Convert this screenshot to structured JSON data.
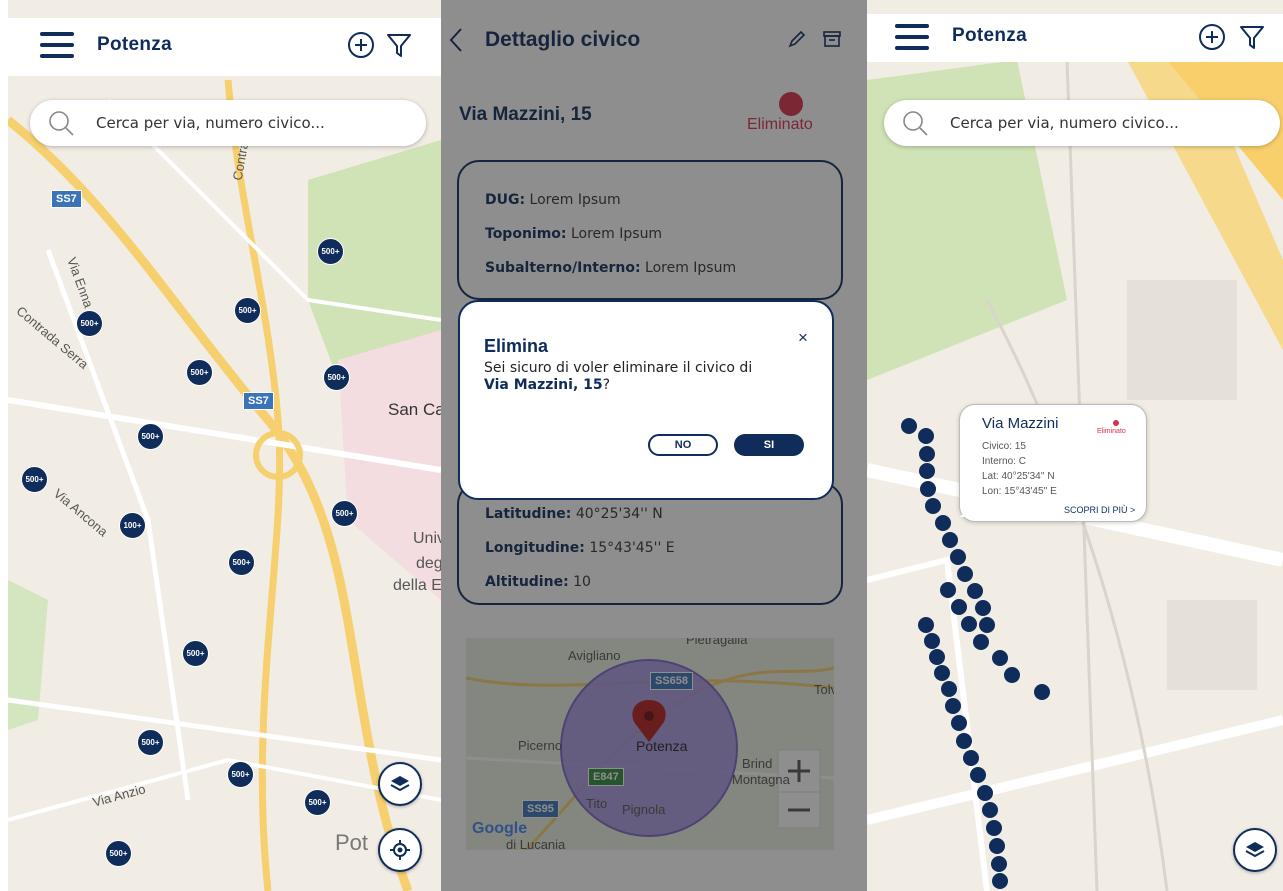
{
  "city": "Potenza",
  "search": {
    "placeholder": "Cerca per via, numero civico..."
  },
  "screen1": {
    "labels": [
      "Contrad",
      "Via Enna",
      "Contrada Serra",
      "San Ca",
      "Via Ancona",
      "Univ",
      "deg",
      "della E",
      "Via Anzio",
      "Pot"
    ],
    "shields": [
      "SS7",
      "SS7"
    ],
    "markers": [
      "500+",
      "500+",
      "500+",
      "500+",
      "500+",
      "500+",
      "500+",
      "500+",
      "500+",
      "500+",
      "500+",
      "500+",
      "500+"
    ],
    "small_marker": "100+"
  },
  "screen2": {
    "title": "Dettaglio civico",
    "address": "Via Mazzini, 15",
    "status": "Eliminato",
    "card1": {
      "dug_label": "DUG:",
      "dug_value": "Lorem Ipsum",
      "toponimo_label": "Toponimo:",
      "toponimo_value": "Lorem Ipsum",
      "subalterno_label": "Subalterno/Interno:",
      "subalterno_value": "Lorem Ipsum"
    },
    "card2": {
      "lat_label": "Latitudine:",
      "lat_value": "40°25'34'' N",
      "lon_label": "Longitudine:",
      "lon_value": "15°43'45'' E",
      "alt_label": "Altitudine:",
      "alt_value": "10"
    },
    "mini_map": {
      "labels": [
        "Pietragalla",
        "Avigliano",
        "Tolv",
        "Picerno",
        "Potenza",
        "Brind",
        "Montagna",
        "Tito",
        "Pignola",
        "Google",
        "di Lucania"
      ],
      "shields": [
        "SS658",
        "E847",
        "SS95"
      ]
    },
    "dialog": {
      "title": "Elimina",
      "close": "×",
      "message": "Sei sicuro di voler eliminare il civico di",
      "address": "Via Mazzini, 15",
      "suffix": "?",
      "no": "NO",
      "si": "SI"
    }
  },
  "screen3": {
    "popup": {
      "title": "Via Mazzini",
      "status": "Eliminato",
      "civico": "Civico: 15",
      "interno": "Interno: C",
      "lat": "Lat: 40°25'34'' N",
      "lon": "Lon: 15°43'45'' E",
      "more": "SCOPRI DI PIÙ >"
    }
  },
  "colors": {
    "navy": "#0f2c5a",
    "danger": "#d9304a",
    "map_bg": "#f1ece4",
    "park": "#cfe3b6"
  }
}
